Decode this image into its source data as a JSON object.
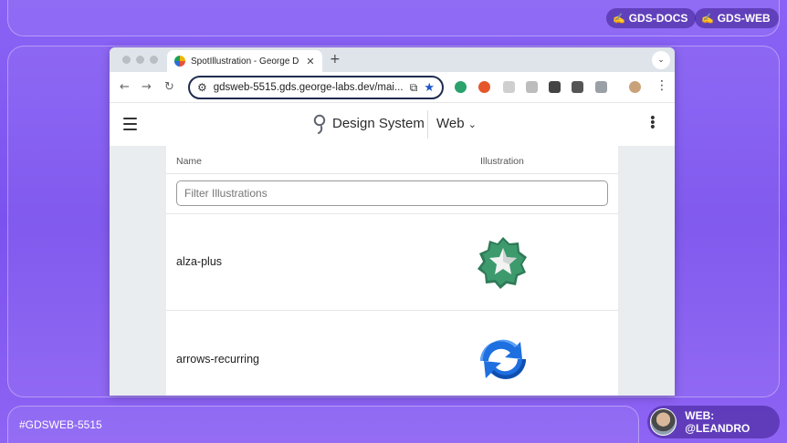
{
  "overlay": {
    "top_pills": [
      {
        "icon": "✍",
        "label": "GDS-DOCS"
      },
      {
        "icon": "✍",
        "label": "GDS-WEB"
      }
    ],
    "ticket": "#GDSWEB-5515",
    "author": "WEB: @LEANDRO"
  },
  "browser": {
    "tab_title": "SpotIllustration - George Design System",
    "url": "gdsweb-5515.gds.george-labs.dev/mai..."
  },
  "site": {
    "brand": "Design System",
    "platform": "Web"
  },
  "table": {
    "columns": [
      "Name",
      "Illustration"
    ],
    "filter_placeholder": "Filter Illustrations",
    "rows": [
      {
        "name": "alza-plus",
        "illustration": "badge-star-icon"
      },
      {
        "name": "arrows-recurring",
        "illustration": "arrows-recurring-icon"
      }
    ]
  },
  "colors": {
    "background": "#7b52ee",
    "omnibox_border": "#1f2c4f",
    "badge_green": "#2f7a57",
    "arrows_blue": "#1e6fe0"
  }
}
